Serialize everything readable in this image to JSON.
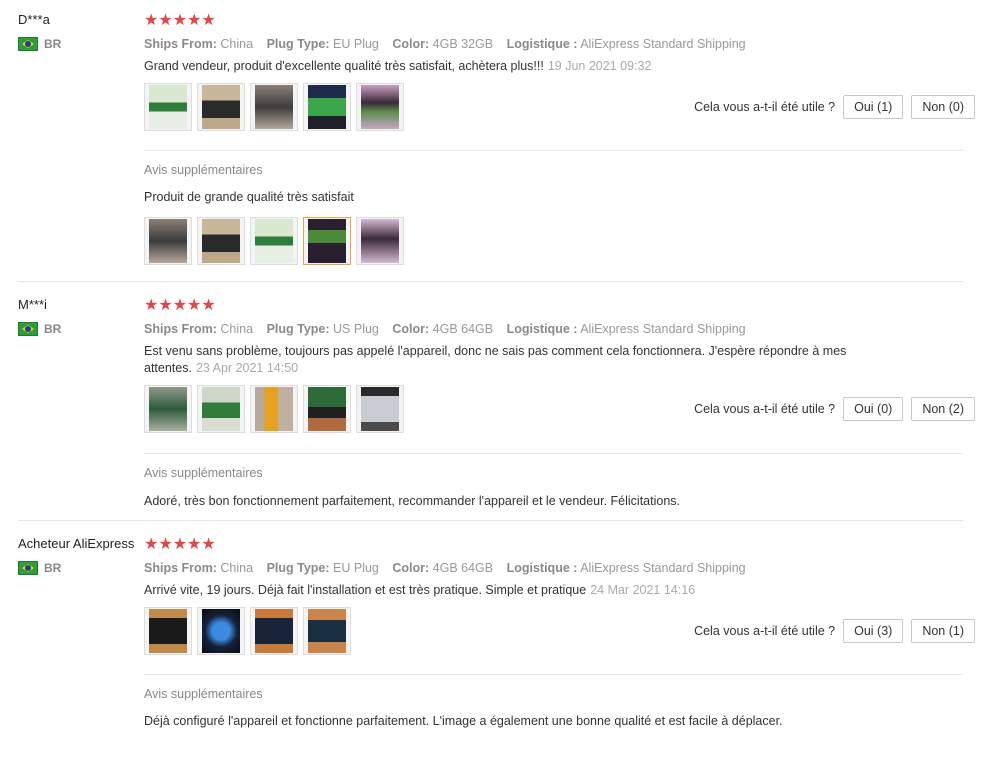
{
  "reviews": [
    {
      "user": "D***a",
      "country": "BR",
      "stars": "★★★★★",
      "meta": {
        "ships_label": "Ships From:",
        "ships": "China",
        "plug_label": "Plug Type:",
        "plug": "EU Plug",
        "color_label": "Color:",
        "color": "4GB 32GB",
        "log_label": "Logistique :",
        "log": "AliExpress Standard Shipping"
      },
      "text": "Grand vendeur, produit d'excellente qualité très satisfait, achètera plus!!!",
      "date": "19 Jun 2021 09:32",
      "helpful_q": "Cela vous a-t-il été utile ?",
      "yes": "Oui (1)",
      "no": "Non (0)",
      "addl_title": "Avis supplémentaires",
      "addl_text": "Produit de grande qualité très satisfait"
    },
    {
      "user": "M***i",
      "country": "BR",
      "stars": "★★★★★",
      "meta": {
        "ships_label": "Ships From:",
        "ships": "China",
        "plug_label": "Plug Type:",
        "plug": "US Plug",
        "color_label": "Color:",
        "color": "4GB 64GB",
        "log_label": "Logistique :",
        "log": "AliExpress Standard Shipping"
      },
      "text": "Est venu sans problème, toujours pas appelé l'appareil, donc ne sais pas comment cela fonctionnera. J'espère répondre à mes attentes.",
      "date": "23 Apr 2021 14:50",
      "helpful_q": "Cela vous a-t-il été utile ?",
      "yes": "Oui (0)",
      "no": "Non (2)",
      "addl_title": "Avis supplémentaires",
      "addl_text": "Adoré, très bon fonctionnement parfaitement, recommander l'appareil et le vendeur. Félicitations."
    },
    {
      "user": "Acheteur AliExpress",
      "country": "BR",
      "stars": "★★★★★",
      "meta": {
        "ships_label": "Ships From:",
        "ships": "China",
        "plug_label": "Plug Type:",
        "plug": "EU Plug",
        "color_label": "Color:",
        "color": "4GB 64GB",
        "log_label": "Logistique :",
        "log": "AliExpress Standard Shipping"
      },
      "text": "Arrivé vite, 19 jours. Déjà fait l'installation et est très pratique. Simple et pratique",
      "date": "24 Mar 2021 14:16",
      "helpful_q": "Cela vous a-t-il été utile ?",
      "yes": "Oui (3)",
      "no": "Non (1)",
      "addl_title": "Avis supplémentaires",
      "addl_text": "Déjà configuré l'appareil et fonctionne parfaitement. L'image a également une bonne qualité et est facile à déplacer."
    }
  ],
  "colors": {
    "star": "#e64545",
    "accent_border": "#e8a44a"
  }
}
